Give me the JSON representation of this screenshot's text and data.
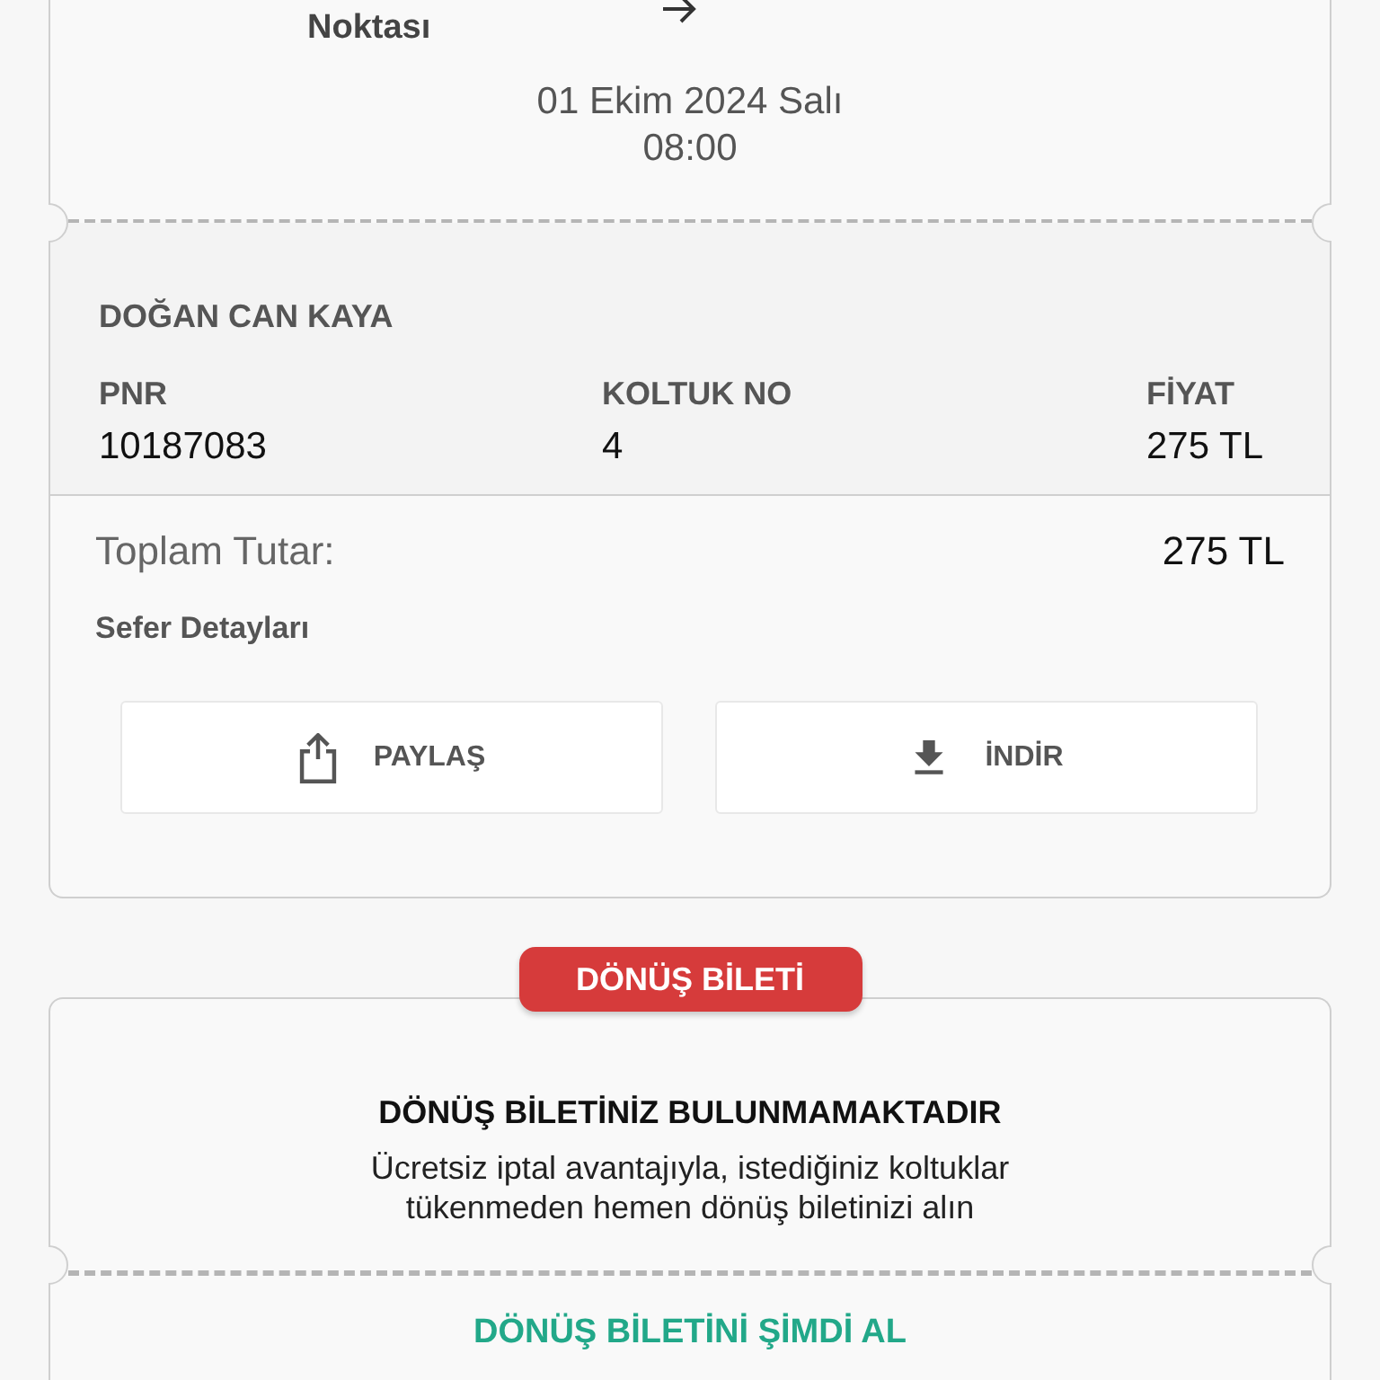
{
  "outbound": {
    "route": {
      "origin": "Noktası"
    },
    "date": "01 Ekim 2024 Salı",
    "time": "08:00",
    "passenger": {
      "name": "DOĞAN CAN KAYA",
      "fields": [
        {
          "label": "PNR",
          "value": "10187083"
        },
        {
          "label": "KOLTUK NO",
          "value": "4"
        },
        {
          "label": "FİYAT",
          "value": "275 TL"
        }
      ]
    },
    "total": {
      "label": "Toplam Tutar:",
      "value": "275 TL"
    },
    "details_title": "Sefer Detayları",
    "actions": [
      {
        "kind": "share",
        "label": "PAYLAŞ"
      },
      {
        "kind": "download",
        "label": "İNDİR"
      }
    ]
  },
  "return": {
    "badge": "DÖNÜŞ BİLETİ",
    "title": "DÖNÜŞ BİLETİNİZ BULUNMAMAKTADIR",
    "message": "Ücretsiz iptal avantajıyla, istediğiniz koltuklar tükenmeden hemen dönüş biletinizi alın",
    "action": "DÖNÜŞ BİLETİNİ ŞİMDİ AL"
  }
}
